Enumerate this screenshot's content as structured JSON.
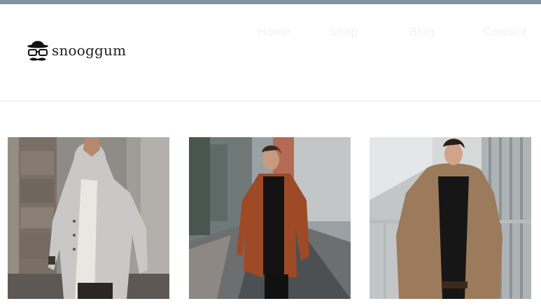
{
  "brand": {
    "name": "snooggum",
    "logo_icon": "bowler-hat-glasses-mustache-icon"
  },
  "nav": {
    "items": [
      {
        "label": "Home"
      },
      {
        "label": "Shop"
      },
      {
        "label": "Blog"
      },
      {
        "label": "Contact"
      }
    ]
  },
  "products": [
    {
      "alt": "Man in light grey hooded coat"
    },
    {
      "alt": "Man in rust brown coat on street"
    },
    {
      "alt": "Man in brown puffer jacket"
    }
  ],
  "colors": {
    "top_bar": "#7f93a2",
    "background": "#ffffff",
    "nav_text": "#f2f2f2"
  }
}
